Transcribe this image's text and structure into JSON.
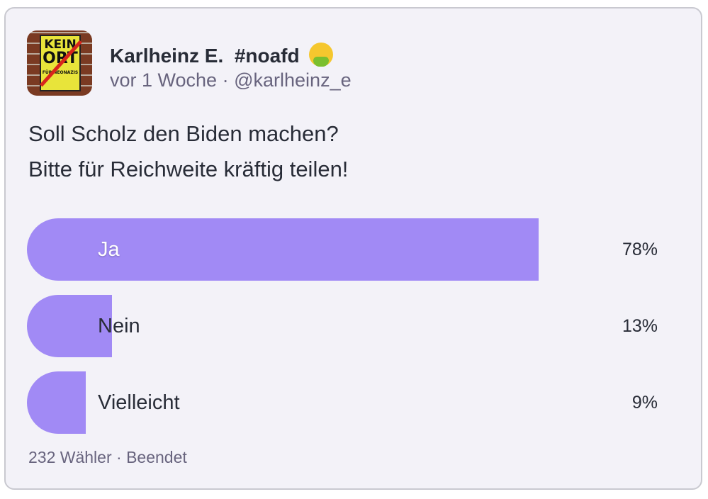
{
  "author": {
    "display_name": "Karlheinz E.",
    "hashtag": "#noafd",
    "emoji_icon": "vomiting-face-icon",
    "time_ago": "vor 1 Woche",
    "separator": "·",
    "handle": "@karlheinz_e",
    "avatar_text": [
      "KEIN",
      "ORT",
      "FÜR NEONAZIS"
    ]
  },
  "post": {
    "lines": [
      "Soll Scholz den Biden machen?",
      "Bitte für Reichweite kräftig teilen!"
    ]
  },
  "poll": {
    "bar_color": "#a18af5",
    "options": [
      {
        "label": "Ja",
        "percent_label": "78%",
        "fraction": 0.78
      },
      {
        "label": "Nein",
        "percent_label": "13%",
        "fraction": 0.13
      },
      {
        "label": "Vielleicht",
        "percent_label": "9%",
        "fraction": 0.09
      }
    ],
    "voters": "232 Wähler",
    "separator": "·",
    "status": "Beendet"
  }
}
